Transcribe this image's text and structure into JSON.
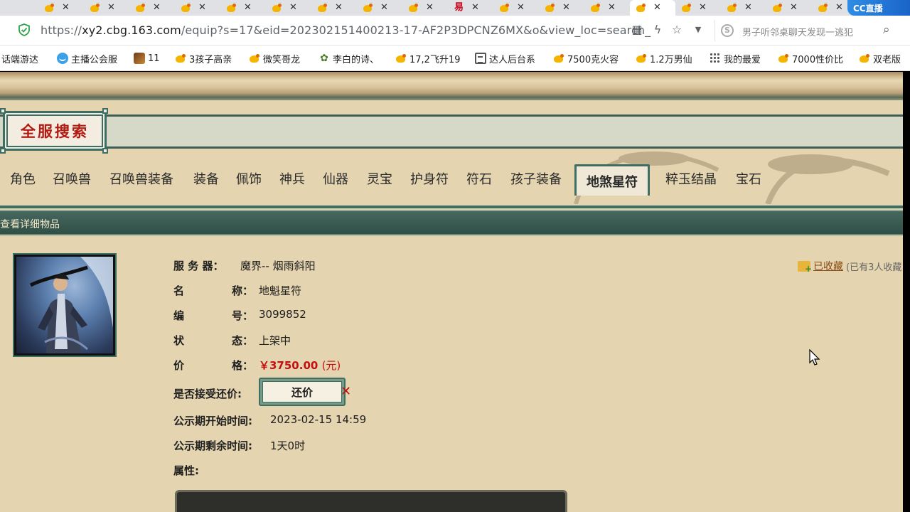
{
  "browser": {
    "tab_count": 20,
    "active_tab_index": 13,
    "special_tab_index": 9,
    "special_tab_glyph": "易",
    "cc_logo": "CC直播",
    "url_prefix": "https://",
    "url_host": "xy2.cbg.163.com",
    "url_path": "/equip?s=17&eid=202302151400213-17-AF2P3DPCNZ6MX&o&view_loc=search_",
    "search_placeholder": "男子听邻桌聊天发现一逃犯"
  },
  "bookmarks": [
    {
      "label": "话端游达",
      "icon": "none"
    },
    {
      "label": "主播公会服",
      "icon": "smile-icon"
    },
    {
      "label": "11",
      "icon": "game-icon"
    },
    {
      "label": "3孩子高亲",
      "icon": "chick-icon"
    },
    {
      "label": "微笑哥龙",
      "icon": "chick-icon"
    },
    {
      "label": "李白的诗、",
      "icon": "plant-icon"
    },
    {
      "label": "17,2飞升19",
      "icon": "chick-icon"
    },
    {
      "label": "达人后台系",
      "icon": "doc-icon"
    },
    {
      "label": "7500克火容",
      "icon": "chick-icon"
    },
    {
      "label": "1.2万男仙",
      "icon": "chick-icon"
    },
    {
      "label": "我的最爱",
      "icon": "grid-icon"
    },
    {
      "label": "7000性价比",
      "icon": "chick-icon"
    },
    {
      "label": "双老版",
      "icon": "chick-icon"
    }
  ],
  "page": {
    "search_title": "全服搜索",
    "categories": [
      "角色",
      "召唤兽",
      "召唤兽装备",
      "装备",
      "佩饰",
      "神兵",
      "仙器",
      "灵宝",
      "护身符",
      "符石",
      "孩子装备",
      "地煞星符",
      "粹玉结晶",
      "宝石"
    ],
    "active_category": "地煞星符",
    "detail_header": "查看详细物品",
    "fields": {
      "server_label": "服 务 器：",
      "server_value": "魔界-- 烟雨斜阳",
      "name_label_a": "名",
      "name_label_b": "称：",
      "name_value": "地魁星符",
      "id_label_a": "编",
      "id_label_b": "号：",
      "id_value": "3099852",
      "status_label_a": "状",
      "status_label_b": "态：",
      "status_value": "上架中",
      "price_label_a": "价",
      "price_label_b": "格：",
      "price_value": "￥3750.00",
      "price_unit": "(元)",
      "haggle_label": "是否接受还价:",
      "haggle_button": "还价",
      "publicity_start_label": "公示期开始时间:",
      "publicity_start_value": "2023-02-15 14:59",
      "publicity_remain_label": "公示期剩余时间:",
      "publicity_remain_value": "1天0时",
      "attributes_label": "属性:"
    },
    "favorite": {
      "link": "已收藏",
      "count_text": "(已有3人收藏"
    }
  },
  "colors": {
    "teal_border": "#3d6e64",
    "header_green": "#2f4f47",
    "parchment": "#e4d4b0",
    "price_red": "#c41010"
  }
}
